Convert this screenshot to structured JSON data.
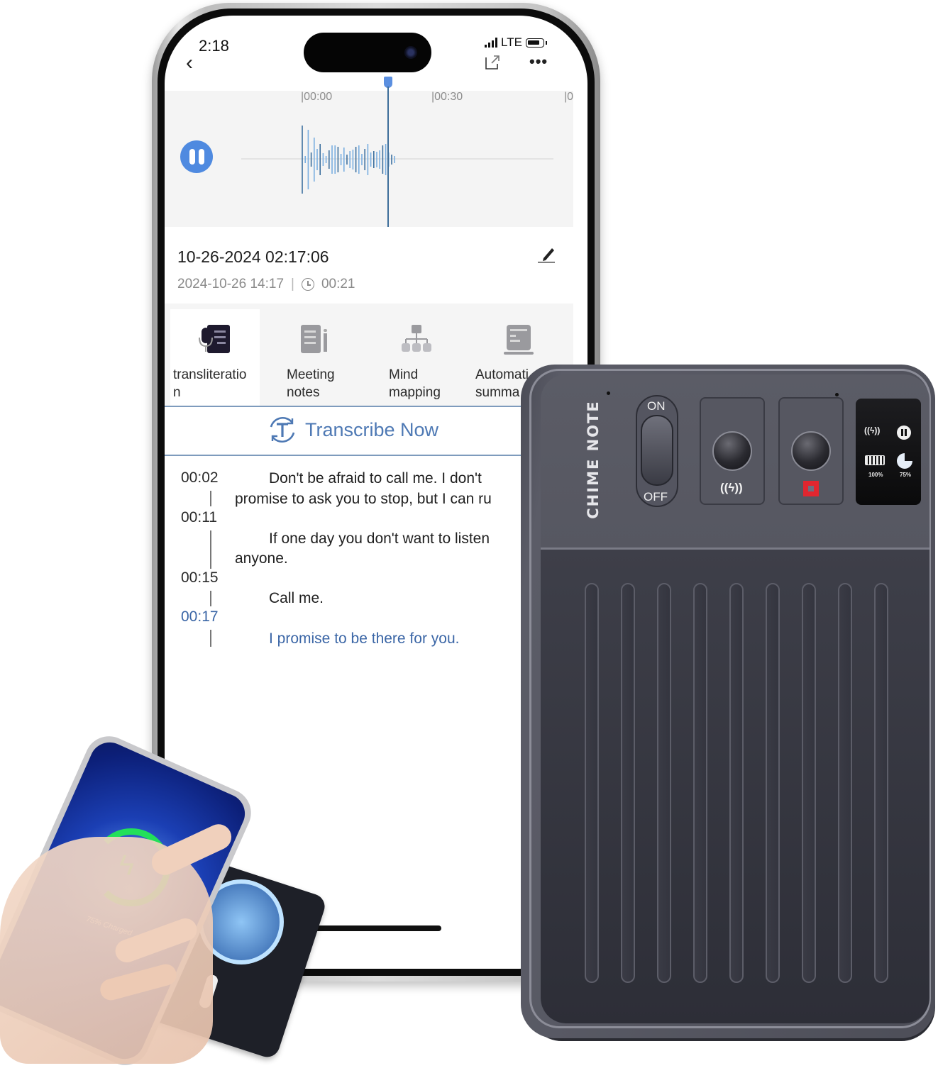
{
  "app": {
    "status_bar": {
      "time": "2:18",
      "network": "LTE",
      "icons": [
        "signal-icon",
        "battery-icon"
      ]
    },
    "nav": {
      "back_icon": "chevron-left-icon",
      "share_icon": "share-icon",
      "more_icon": "more-icon",
      "more_glyph": "•••"
    },
    "player": {
      "timeline_ticks": [
        "|00:00",
        "|00:30",
        "|0"
      ],
      "state": "playing",
      "pause_icon": "pause-icon"
    },
    "recording": {
      "title": "10-26-2024 02:17:06",
      "datetime": "2024-10-26 14:17",
      "separator": "|",
      "duration": "00:21",
      "edit_icon": "pencil-icon"
    },
    "tabs": [
      {
        "label": "transliteratio\nn",
        "icon": "transliteration-icon",
        "active": true
      },
      {
        "label": "Meeting\nnotes",
        "icon": "meeting-notes-icon",
        "active": false
      },
      {
        "label": "Mind\nmapping",
        "icon": "mind-map-icon",
        "active": false
      },
      {
        "label": "Automati\nsumma",
        "icon": "summary-icon",
        "active": false
      }
    ],
    "transcribe_button": {
      "label": "Transcribe Now",
      "icon": "transcribe-icon"
    },
    "transcript": [
      {
        "time": "00:02",
        "line1": "Don't be afraid to call me. I don't",
        "line2": "promise to ask you to stop, but I can ru",
        "active": false
      },
      {
        "time": "00:11",
        "line1": "If one day you don't want to listen",
        "line2": "anyone.",
        "active": false
      },
      {
        "time": "00:15",
        "line1": "Call me.",
        "line2": "",
        "active": false
      },
      {
        "time": "00:17",
        "line1": "I promise to be there for you.",
        "line2": "",
        "active": true
      }
    ],
    "colors": {
      "accent": "#4f8ae0",
      "link_blue": "#4e79b4",
      "active_text": "#3b66a6"
    }
  },
  "device": {
    "brand": "CHIME NOTE",
    "switch": {
      "on_label": "ON",
      "off_label": "OFF"
    },
    "buttons": [
      {
        "name": "wireless-charge-button",
        "icon_glyph": "((ϟ))"
      },
      {
        "name": "record-button",
        "icon": "record-icon"
      }
    ],
    "display": {
      "battery_label": "100%",
      "storage_label": "75%",
      "wireless_glyph": "((ϟ))"
    },
    "colors": {
      "body": "#4d4e58",
      "record_red": "#e0262f"
    }
  },
  "inset": {
    "charging_label": "75% Charged",
    "bolt_glyph": "ϟ"
  }
}
